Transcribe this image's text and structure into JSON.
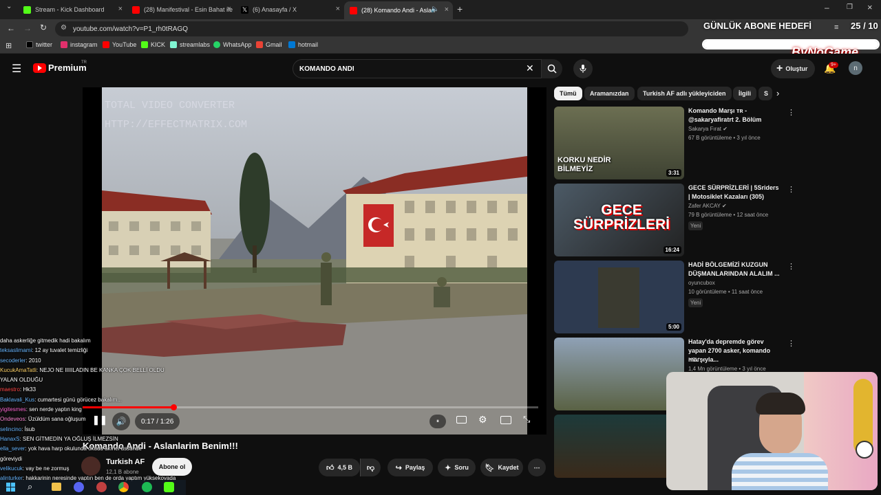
{
  "tabs": [
    {
      "label": "Stream - Kick Dashboard",
      "color": "#53fc18"
    },
    {
      "label": "(28) Manifestival - Esin Bahat ile",
      "color": "#ff0000"
    },
    {
      "label": "(6) Anasayfa / X",
      "color": "#000000"
    },
    {
      "label": "(28) Komando Andi - Aslan",
      "color": "#ff0000"
    }
  ],
  "address": {
    "url": "youtube.com/watch?v=P1_rh0tRAGQ"
  },
  "bookmarks": [
    {
      "label": "twitter",
      "color": "#000000"
    },
    {
      "label": "instagram",
      "color": "#e1306c"
    },
    {
      "label": "YouTube",
      "color": "#ff0000"
    },
    {
      "label": "KICK",
      "color": "#53fc18"
    },
    {
      "label": "streamlabs",
      "color": "#80f5d2"
    },
    {
      "label": "WhatsApp",
      "color": "#25d366"
    },
    {
      "label": "Gmail",
      "color": "#ea4335"
    },
    {
      "label": "hotmail",
      "color": "#0078d4"
    }
  ],
  "overlay": {
    "goal_title": "GÜNLÜK ABONE HEDEFİ",
    "goal_count": "25 / 10",
    "brand": "ByNoGame",
    "goal_progress": 1.0
  },
  "yt": {
    "logo_text": "Premium",
    "logo_sup": "TR",
    "search_value": "KOMANDO ANDI",
    "create_label": "Oluştur",
    "notif_count": "9+",
    "avatar_letter": "n"
  },
  "player": {
    "watermark_line1": "TOTAL VIDEO CONVERTER",
    "watermark_line2": "HTTP://EFFECTMATRIX.COM",
    "time": "0:17 / 1:26",
    "progress": 0.2
  },
  "video": {
    "title": "Komando Andi - Aslanlarim Benim!!!",
    "channel": "Turkish AF",
    "subs": "12,1 B abone",
    "subscribe_label": "Abone ol",
    "likes": "4,5 B",
    "share_label": "Paylaş",
    "ask_label": "Soru",
    "save_label": "Kaydet"
  },
  "chips": [
    "Tümü",
    "Aramanızdan",
    "Turkish AF adlı yükleyiciden",
    "İlgili",
    "S"
  ],
  "recommendations": [
    {
      "title": "Komando Marşı ᴛʀ - @sakaryafiratrt 2. Bölüm",
      "channel": "Sakarya Fırat ✔",
      "meta": "67 B görüntüleme • 3 yıl önce",
      "badge": "",
      "duration": "3:31",
      "thumb_text": "KORKU NEDİR BİLMEYİZ"
    },
    {
      "title": "GECE SÜRPRİZLERİ | 5Sriders | Motosiklet Kazaları (305)",
      "channel": "Zafer AKCAY ✔",
      "meta": "79 B görüntüleme • 12 saat önce",
      "badge": "Yeni",
      "duration": "16:24",
      "thumb_text": "GECE SÜRPRİZLERİ"
    },
    {
      "title": "HADİ BÖLGEMİZİ KUZGUN DÜŞMANLARINDAN ALALIM ...",
      "channel": "oyuncubox",
      "meta": "10 görüntüleme • 11 saat önce",
      "badge": "Yeni",
      "duration": "5:00",
      "thumb_text": ""
    },
    {
      "title": "Hatay'da depremde görev yapan 2700 asker, komando marşıyla...",
      "channel": "NTV ✔",
      "meta": "1,4 Mn görüntüleme • 3 yıl önce",
      "badge": "",
      "duration": "",
      "thumb_text": ""
    }
  ],
  "chat": [
    {
      "user": "",
      "text": "daha askerliğe gitmedik hadi bakalım",
      "color": "#c06aff"
    },
    {
      "user": "teksaslimami",
      "text": ": 12 ay tuvalet temizliği",
      "color": "#6ab7ff"
    },
    {
      "user": "secoderler",
      "text": ": 2010",
      "color": "#6ab7ff"
    },
    {
      "user": "KucukAmaTatli",
      "text": ": NEJO NE IIIIILADIN BE KANKA ÇOK BELLİ OLDU",
      "color": "#ffd36a"
    },
    {
      "user": "",
      "text": "YALAN OLDUĞU",
      "color": "#ffffff"
    },
    {
      "user": "maestro",
      "text": ": Hk33",
      "color": "#ff4a4a"
    },
    {
      "user": "Baklavali_Kus",
      "text": ": cumartesi günü görücez bakalım...",
      "color": "#6ab7ff"
    },
    {
      "user": "yigitesmes",
      "text": ": sen nerde yaptın king",
      "color": "#ff6ad5"
    },
    {
      "user": "Ondeveos",
      "text": ": Üzüldüm sana oğluşum",
      "color": "#ff8ad8"
    },
    {
      "user": "selincino",
      "text": ": Ísub",
      "color": "#6ab7ff"
    },
    {
      "user": "HanaxS",
      "text": ": SEN GİTMEDİN YA OĞLUŞ İLMEZSİN",
      "color": "#6ab7ff"
    },
    {
      "user": "ella_sever",
      "text": ": yok hava harp okulunda okudu akıncı üssünde",
      "color": "#6ab7ff"
    },
    {
      "user": "",
      "text": "göreviydi",
      "color": "#ffffff"
    },
    {
      "user": "velikucuk",
      "text": ": vay be ne zormuş",
      "color": "#6ab7ff"
    },
    {
      "user": "alinturker",
      "text": ": hakkarinin neresinde yaptın ben de orda yaptım yüksekovada",
      "color": "#6ab7ff"
    }
  ]
}
